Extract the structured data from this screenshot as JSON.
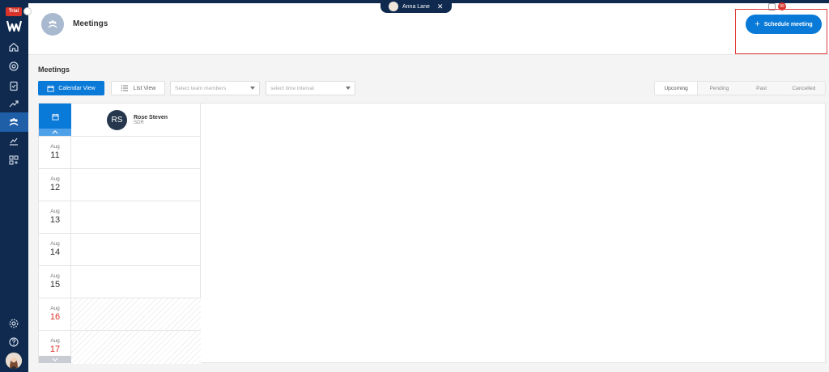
{
  "sidebar": {
    "trial_label": "Trial",
    "nav": [
      "home-icon",
      "target-icon",
      "clipboard-icon",
      "handshake-icon",
      "meetings-icon",
      "chart-icon",
      "apps-icon"
    ],
    "bottom": [
      "settings-icon",
      "help-icon"
    ]
  },
  "topbar": {
    "user_name": "Anna Lane",
    "notification_count": "99"
  },
  "header": {
    "title": "Meetings",
    "schedule_button": "Schedule meeting"
  },
  "section": {
    "title": "Meetings",
    "calendar_view": "Calendar View",
    "list_view": "List View",
    "team_placeholder": "Select team members",
    "time_placeholder": "select time interval"
  },
  "status_tabs": [
    "Upcoming",
    "Pending",
    "Past",
    "Cancelled"
  ],
  "calendar": {
    "user": {
      "initials": "RS",
      "name": "Rose Steven",
      "role": "SDR"
    },
    "days": [
      {
        "month": "Aug",
        "day": "11",
        "weekend": false
      },
      {
        "month": "Aug",
        "day": "12",
        "weekend": false
      },
      {
        "month": "Aug",
        "day": "13",
        "weekend": false
      },
      {
        "month": "Aug",
        "day": "14",
        "weekend": false
      },
      {
        "month": "Aug",
        "day": "15",
        "weekend": false
      },
      {
        "month": "Aug",
        "day": "16",
        "weekend": true
      },
      {
        "month": "Aug",
        "day": "17",
        "weekend": true
      }
    ]
  },
  "colors": {
    "primary": "#0a7ad9",
    "sidebar": "#0f2a4e",
    "weekend": "#d9342b",
    "highlight": "#e23c3c"
  }
}
